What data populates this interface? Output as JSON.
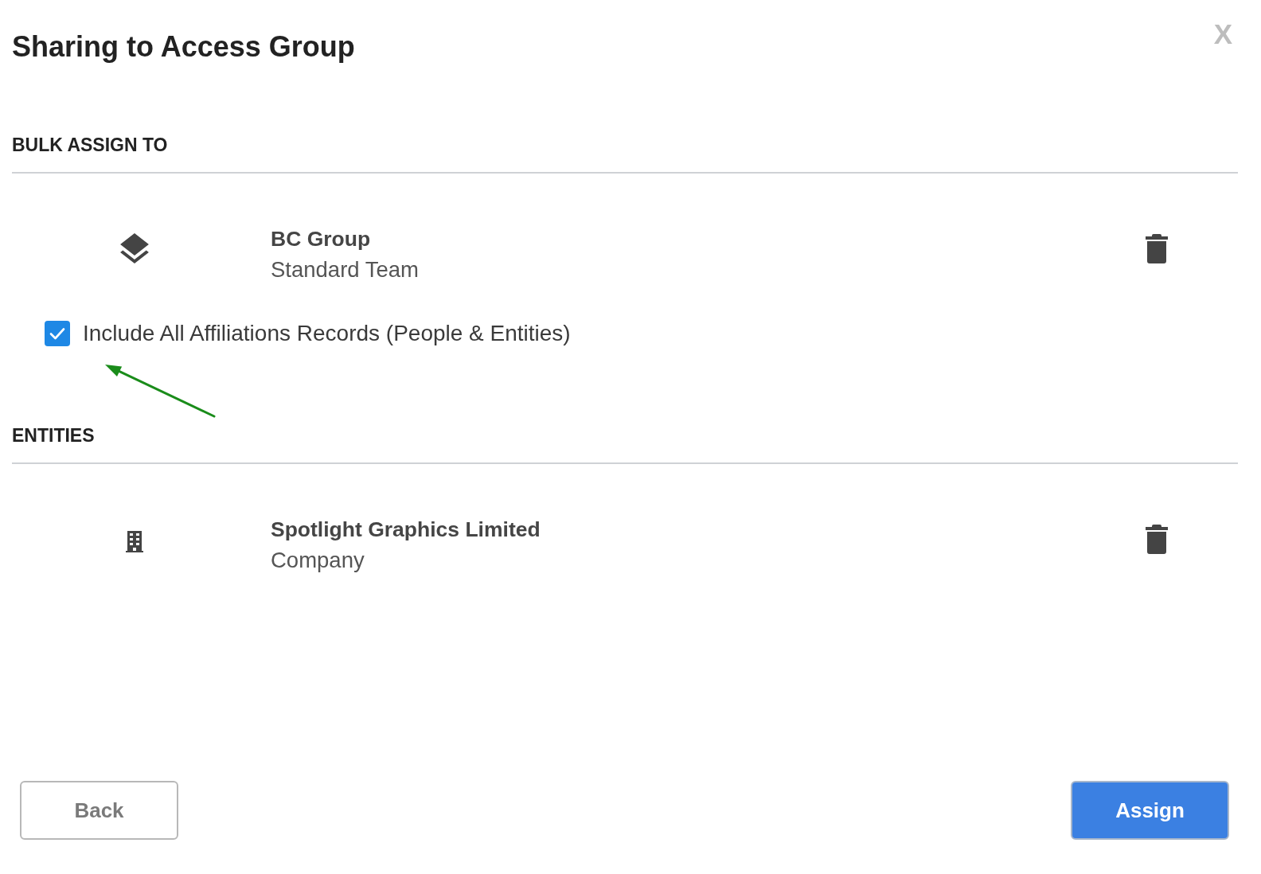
{
  "dialog": {
    "title": "Sharing to Access Group",
    "close_label": "X"
  },
  "sections": [
    {
      "heading": "BULK ASSIGN TO",
      "items": [
        {
          "kind": "group",
          "name": "BC Group",
          "subtitle": "Standard Team",
          "option": {
            "label": "Include All Affiliations Records (People & Entities)",
            "checked": true
          }
        }
      ]
    },
    {
      "heading": "ENTITIES",
      "items": [
        {
          "kind": "company",
          "name": "Spotlight Graphics Limited",
          "subtitle": "Company"
        }
      ]
    }
  ],
  "annotation": {
    "kind": "arrow"
  },
  "buttons": [
    {
      "label": "Back",
      "kind": "secondary"
    },
    {
      "label": "Assign",
      "kind": "primary"
    }
  ]
}
